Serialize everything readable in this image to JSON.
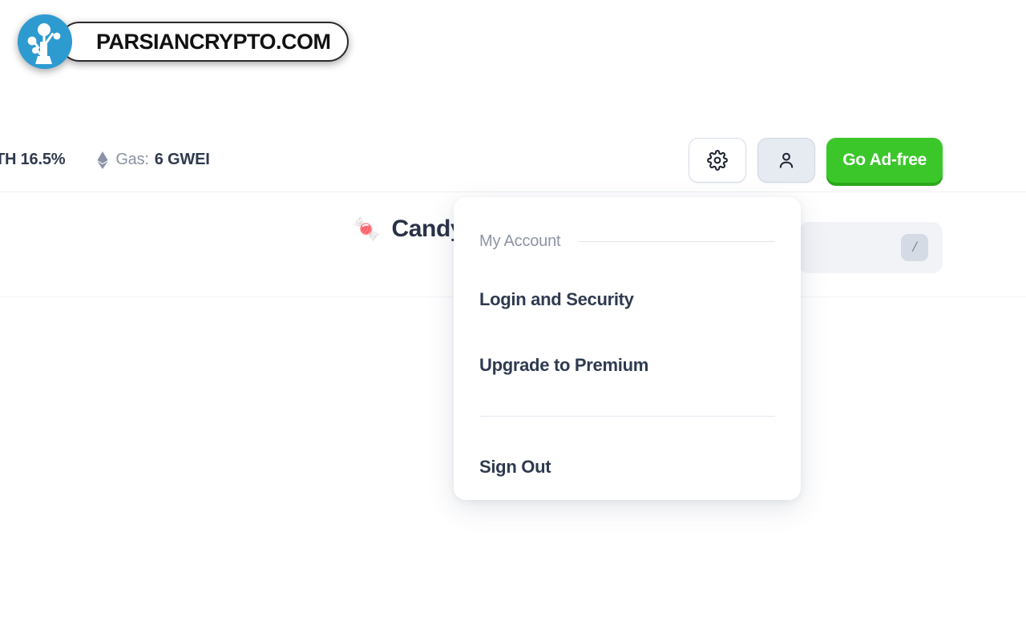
{
  "page": {
    "background_color": "#ffffff"
  },
  "topbar": {
    "eth_stat": "TH 16.5%",
    "gas_icon": "ethereum-diamond-icon",
    "gas_label": "Gas:",
    "gas_value": "6 GWEI",
    "settings_icon": "gear-icon",
    "account_icon": "person-icon",
    "cta_label": "Go Ad-free",
    "cta_color": "#3bc72a"
  },
  "subbar": {
    "title_emoji": "🍬",
    "title": "Candy",
    "search_placeholder": "",
    "search_value": "",
    "search_shortcut": "/"
  },
  "account_menu": {
    "header": "My Account",
    "items": [
      {
        "label": "Login and Security"
      },
      {
        "label": "Upgrade to Premium"
      },
      {
        "label": "Sign Out"
      }
    ]
  },
  "below_fold": {
    "left_text": "",
    "right_text": ""
  },
  "watermark": {
    "text": "PARSIANCRYPTO.COM",
    "badge_icon": "tree-network-logo-icon",
    "badge_color": "#2e9bd0"
  }
}
